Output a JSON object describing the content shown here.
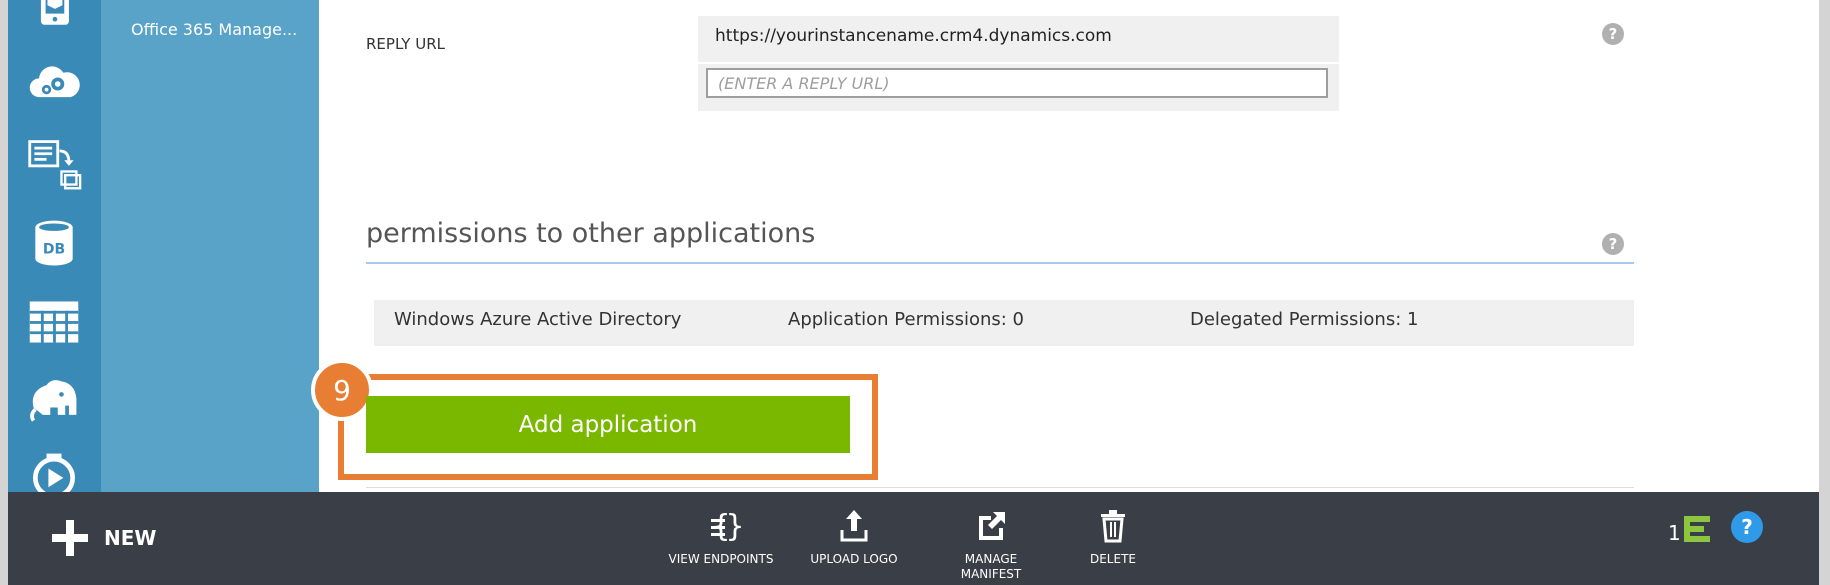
{
  "sidebar": {
    "active_item_label": "Office 365 Manage...",
    "icons": [
      "mobile-service-icon",
      "cloud-service-icon",
      "batch-icon",
      "sql-database-icon",
      "storage-table-icon",
      "hdinsight-elephant-icon",
      "media-services-icon"
    ]
  },
  "reply_url": {
    "label": "REPLY URL",
    "value": "https://yourinstancename.crm4.dynamics.com",
    "placeholder": "(ENTER A REPLY URL)"
  },
  "permissions": {
    "title": "permissions to other applications",
    "rows": [
      {
        "app": "Windows Azure Active Directory",
        "application_permissions": "Application Permissions: 0",
        "delegated_permissions": "Delegated Permissions: 1"
      }
    ]
  },
  "callout": {
    "step_number": "9",
    "color": "#e77e33"
  },
  "add_application_label": "Add application",
  "help_glyph": "?",
  "command_bar": {
    "new_label": "NEW",
    "view_endpoints": "VIEW ENDPOINTS",
    "upload_logo": "UPLOAD LOGO",
    "manage_manifest": "MANAGE MANIFEST",
    "delete": "DELETE",
    "notification_count": "1",
    "help": "?"
  },
  "colors": {
    "icon_rail": "#3a8ab8",
    "nav_panel": "#5aa3c8",
    "add_button": "#7ab800",
    "command_bar": "#3a3f47",
    "accent_green": "#8cc63f",
    "help_blue": "#2f9ae8"
  }
}
